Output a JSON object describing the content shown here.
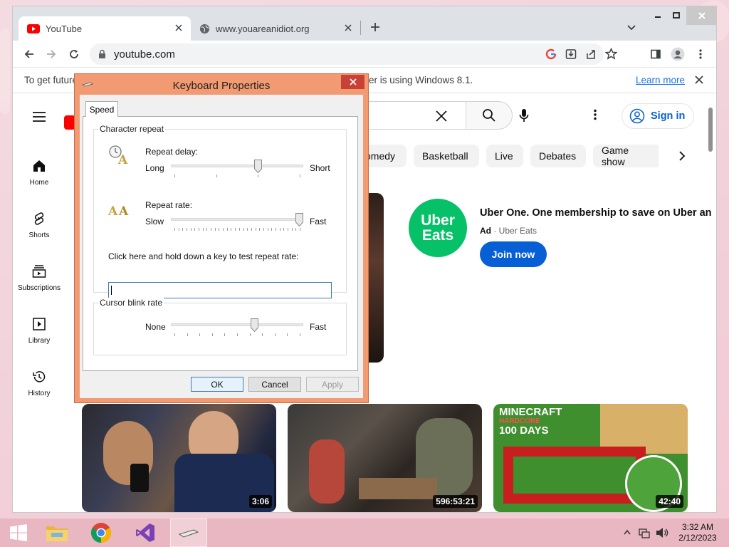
{
  "browser": {
    "tabs": [
      {
        "title": "YouTube",
        "active": true,
        "icon": "youtube-favicon"
      },
      {
        "title": "www.youareanidiot.org",
        "active": false,
        "icon": "globe-icon"
      }
    ],
    "address": "youtube.com",
    "infobar": {
      "text_left": "To get future",
      "text_right": "er is using Windows 8.1.",
      "link": "Learn more"
    }
  },
  "youtube": {
    "sidebar": [
      {
        "label": "Home",
        "icon": "home-icon"
      },
      {
        "label": "Shorts",
        "icon": "shorts-icon"
      },
      {
        "label": "Subscriptions",
        "icon": "subscriptions-icon"
      },
      {
        "label": "Library",
        "icon": "library-icon"
      },
      {
        "label": "History",
        "icon": "history-icon"
      }
    ],
    "sign_in": "Sign in",
    "chips": [
      "omedy",
      "Basketball",
      "Live",
      "Debates",
      "Game show"
    ],
    "ad": {
      "logo_line1": "Uber",
      "logo_line2": "Eats",
      "title": "Uber One. One membership to save on Uber an",
      "ad_badge": "Ad",
      "sponsor": "· Uber Eats",
      "cta": "Join now",
      "brand_color": "#06c167"
    },
    "videos": [
      {
        "duration": "3:06",
        "topic": "ufc-interview"
      },
      {
        "duration": "596:53:21",
        "topic": "sitcom-scene"
      },
      {
        "duration": "42:40",
        "topic": "minecraft-hardcore",
        "overlay_line1": "MINECRAFT",
        "overlay_line2": "HARDCORE",
        "overlay_line3": "100 DAYS"
      }
    ]
  },
  "dialog": {
    "title": "Keyboard Properties",
    "tab": "Speed",
    "character_repeat": {
      "group_title": "Character repeat",
      "repeat_delay": {
        "label": "Repeat delay:",
        "min_label": "Long",
        "max_label": "Short",
        "value_fraction": 0.67,
        "ticks": 4
      },
      "repeat_rate": {
        "label": "Repeat rate:",
        "min_label": "Slow",
        "max_label": "Fast",
        "value_fraction": 1.0,
        "ticks": 32
      },
      "test_label": "Click here and hold down a key to test repeat rate:",
      "test_value": ""
    },
    "cursor_blink": {
      "group_title": "Cursor blink rate",
      "min_label": "None",
      "max_label": "Fast",
      "value_fraction": 0.64,
      "ticks": 11
    },
    "buttons": {
      "ok": "OK",
      "cancel": "Cancel",
      "apply": "Apply"
    }
  },
  "taskbar": {
    "apps": [
      "start-button",
      "file-explorer-icon",
      "chrome-icon",
      "visual-studio-icon",
      "keyboard-icon"
    ],
    "time": "3:32 AM",
    "date": "2/12/2023"
  }
}
